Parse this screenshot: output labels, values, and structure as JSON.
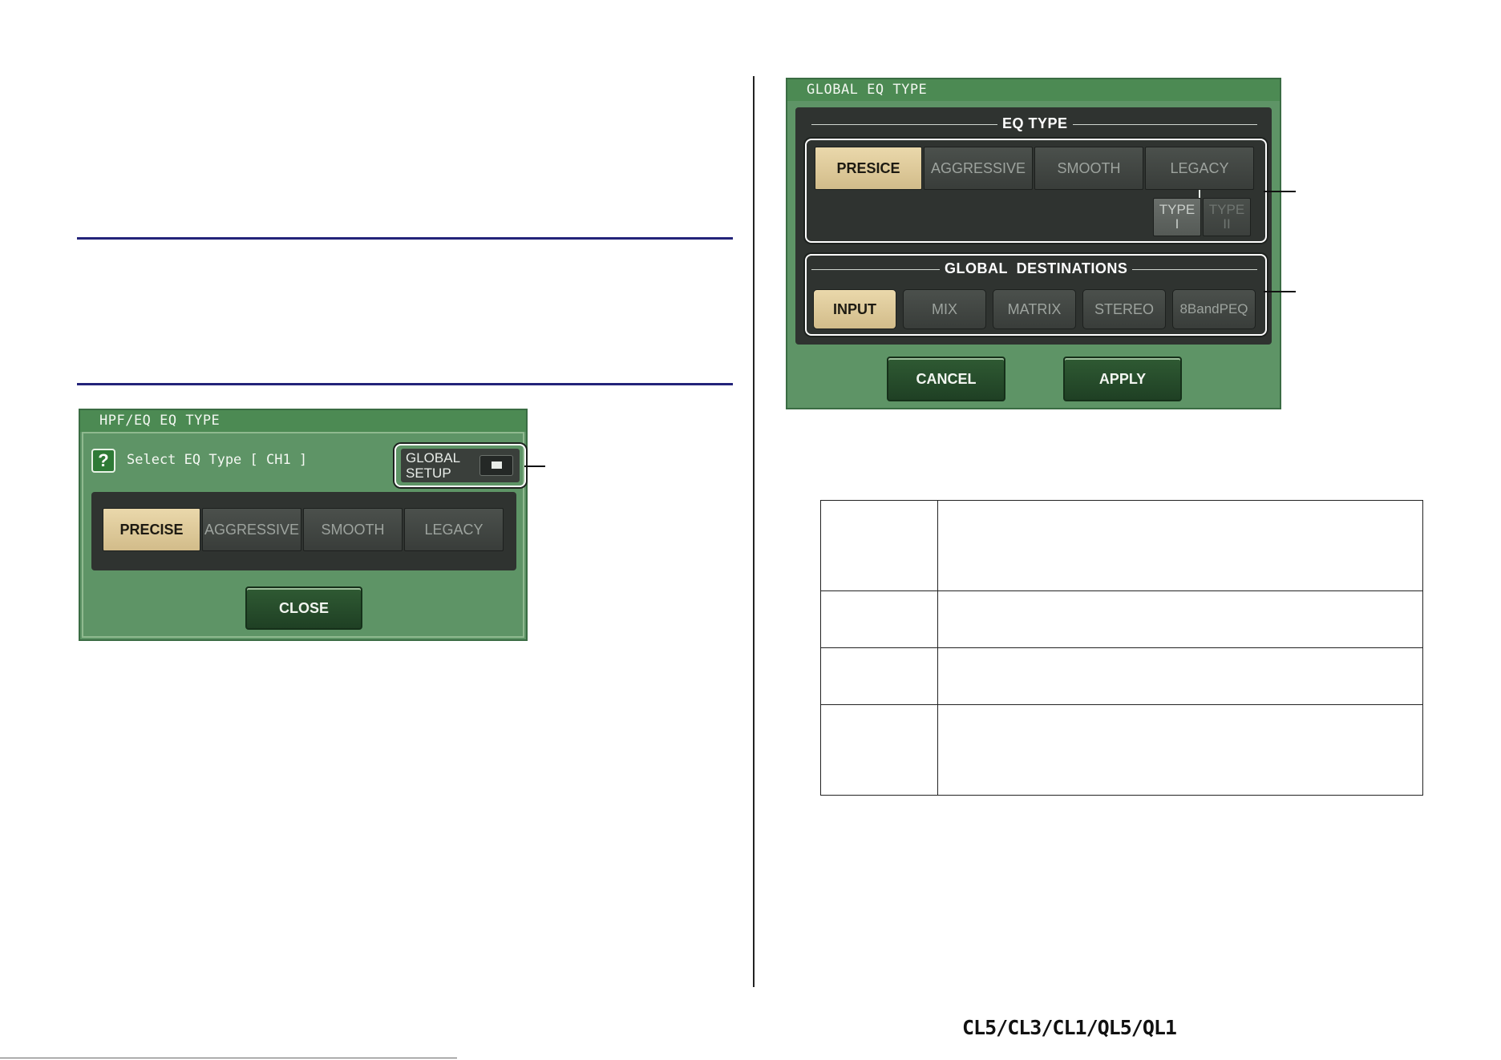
{
  "left_dialog": {
    "title": "HPF/EQ EQ TYPE",
    "help_icon_glyph": "?",
    "prompt": "Select EQ Type [ CH1 ]",
    "global_setup_line1": "GLOBAL",
    "global_setup_line2": "SETUP",
    "eq_types": [
      "PRECISE",
      "AGGRESSIVE",
      "SMOOTH",
      "LEGACY"
    ],
    "selected_eq_type": "PRECISE",
    "close_label": "CLOSE"
  },
  "right_dialog": {
    "title": "GLOBAL EQ TYPE",
    "eq_type_section": "EQ TYPE",
    "eq_types": [
      "PRESICE",
      "AGGRESSIVE",
      "SMOOTH",
      "LEGACY"
    ],
    "selected_eq_type": "PRESICE",
    "legacy_type1_line1": "TYPE",
    "legacy_type1_line2": "I",
    "legacy_type2_line1": "TYPE",
    "legacy_type2_line2": "II",
    "destinations_section": "GLOBAL  DESTINATIONS",
    "destinations": [
      "INPUT",
      "MIX",
      "MATRIX",
      "STEREO",
      "8BandPEQ"
    ],
    "selected_destination": "INPUT",
    "cancel_label": "CANCEL",
    "apply_label": "APPLY"
  },
  "footer": {
    "model_logo": "CL5/CL3/CL1/QL5/QL1"
  },
  "colors": {
    "dialog_green": "#5e9466",
    "title_green": "#4c8a53",
    "selected_tan": "#e2cfa0",
    "rule_blue": "#23237a"
  }
}
